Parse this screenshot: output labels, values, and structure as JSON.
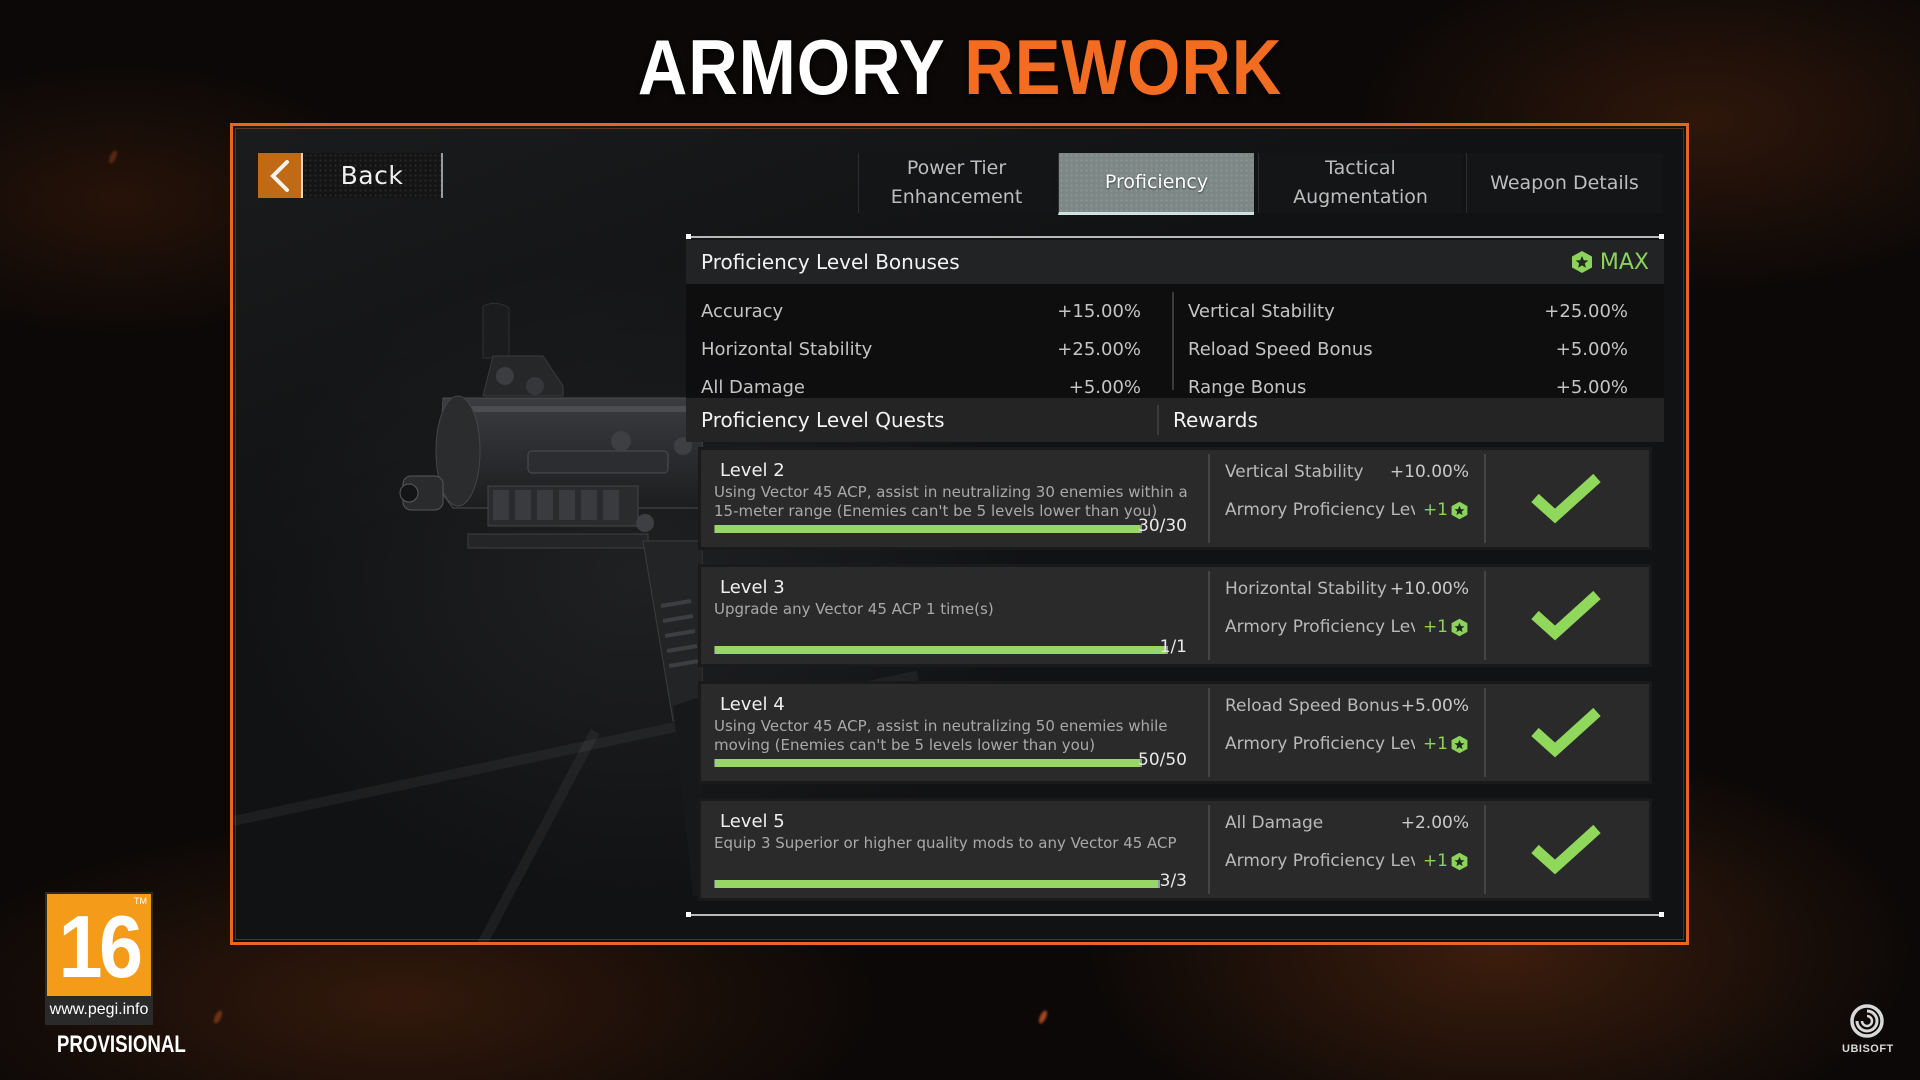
{
  "headline": {
    "part1": "ARMORY",
    "part2": "REWORK"
  },
  "colors": {
    "accent_orange": "#f26c22",
    "frame_orange": "#e8661f",
    "progress_green": "#96d765",
    "max_green": "#8cd35b",
    "back_button": "#c06a15"
  },
  "back_button": {
    "label": "Back",
    "icon": "chevron-left-icon"
  },
  "tabs": [
    {
      "label": "Power Tier Enhancement",
      "line1": "Power Tier",
      "line2": "Enhancement",
      "active": false
    },
    {
      "label": "Proficiency",
      "active": true
    },
    {
      "label": "Tactical Augmentation",
      "active": false
    },
    {
      "label": "Weapon Details",
      "active": false
    }
  ],
  "bonuses": {
    "title": "Proficiency Level Bonuses",
    "status": "MAX",
    "status_icon": "proficiency-star-icon",
    "left": [
      {
        "name": "Accuracy",
        "value": "+15.00%"
      },
      {
        "name": "Horizontal Stability",
        "value": "+25.00%"
      },
      {
        "name": "All Damage",
        "value": "+5.00%"
      }
    ],
    "right": [
      {
        "name": "Vertical Stability",
        "value": "+25.00%"
      },
      {
        "name": "Reload Speed Bonus",
        "value": "+5.00%"
      },
      {
        "name": "Range Bonus",
        "value": "+5.00%"
      }
    ]
  },
  "quests": {
    "title": "Proficiency Level Quests",
    "rewards_title": "Rewards",
    "items": [
      {
        "level": "Level 2",
        "description": "Using Vector 45 ACP, assist in neutralizing 30 enemies within a 15-meter range (Enemies can't be 5 levels lower than you)",
        "progress_text": "30/30",
        "progress": 1.0,
        "reward1_name": "Vertical Stability",
        "reward1_value": "+10.00%",
        "reward2_name": "Armory Proficiency Level",
        "reward2_value": "+1",
        "completed": true
      },
      {
        "level": "Level 3",
        "description": "Upgrade any Vector 45 ACP 1 time(s)",
        "progress_text": "1/1",
        "progress": 1.0,
        "reward1_name": "Horizontal Stability",
        "reward1_value": "+10.00%",
        "reward2_name": "Armory Proficiency Level",
        "reward2_value": "+1",
        "completed": true
      },
      {
        "level": "Level 4",
        "description": "Using Vector 45 ACP, assist in neutralizing 50 enemies while moving (Enemies can't be 5 levels lower than you)",
        "progress_text": "50/50",
        "progress": 1.0,
        "reward1_name": "Reload Speed Bonus",
        "reward1_value": "+5.00%",
        "reward2_name": "Armory Proficiency Level",
        "reward2_value": "+1",
        "completed": true
      },
      {
        "level": "Level 5",
        "description": "Equip 3 Superior or higher quality mods to any Vector 45 ACP",
        "progress_text": "3/3",
        "progress": 1.0,
        "reward1_name": "All Damage",
        "reward1_value": "+2.00%",
        "reward2_name": "Armory Proficiency Level",
        "reward2_value": "+1",
        "completed": true
      }
    ]
  },
  "weapon": {
    "name": "Vector 45 ACP"
  },
  "rating": {
    "age": "16",
    "trademark": "TM",
    "url": "www.pegi.info",
    "note": "PROVISIONAL"
  },
  "publisher": {
    "name": "UBISOFT"
  }
}
